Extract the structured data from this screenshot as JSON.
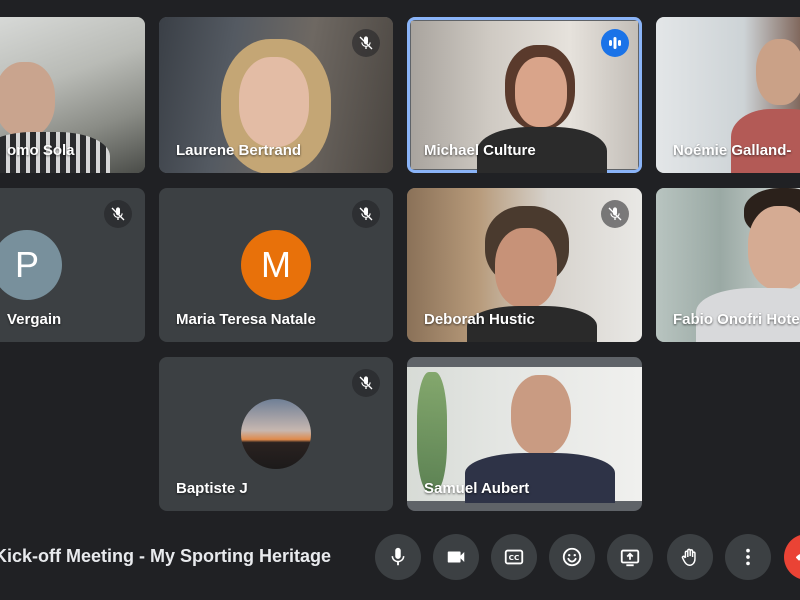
{
  "participants": [
    {
      "name": "omo Sola",
      "state": "video",
      "muted": false
    },
    {
      "name": "Laurene Bertrand",
      "state": "video",
      "muted": true
    },
    {
      "name": "Michael Culture",
      "state": "video",
      "speaking": true
    },
    {
      "name": "Noémie Galland-",
      "state": "video",
      "muted": false
    },
    {
      "name": "Vergain",
      "state": "avatar",
      "initial": "P",
      "avatar_color": "#78909c",
      "muted": true
    },
    {
      "name": "Maria Teresa Natale",
      "state": "avatar",
      "initial": "M",
      "avatar_color": "#e8710a",
      "muted": true
    },
    {
      "name": "Deborah Hustic",
      "state": "video",
      "muted": true
    },
    {
      "name": "Fabio Onofri Hote",
      "state": "video",
      "muted": false
    },
    {
      "name": "Baptiste J",
      "state": "avatar-photo",
      "muted": true
    },
    {
      "name": "Samuel Aubert",
      "state": "video",
      "muted": false
    }
  ],
  "meeting": {
    "title": "Kick-off Meeting - My Sporting Heritage"
  },
  "controls": [
    "microphone-icon",
    "camera-icon",
    "captions-icon",
    "emoji-icon",
    "present-icon",
    "raise-hand-icon",
    "more-options-icon",
    "end-call-icon"
  ],
  "colors": {
    "background": "#202124",
    "tile": "#3c4043",
    "active_border": "#8ab4f8",
    "speaking": "#1a73e8",
    "end_call": "#ea4335"
  }
}
